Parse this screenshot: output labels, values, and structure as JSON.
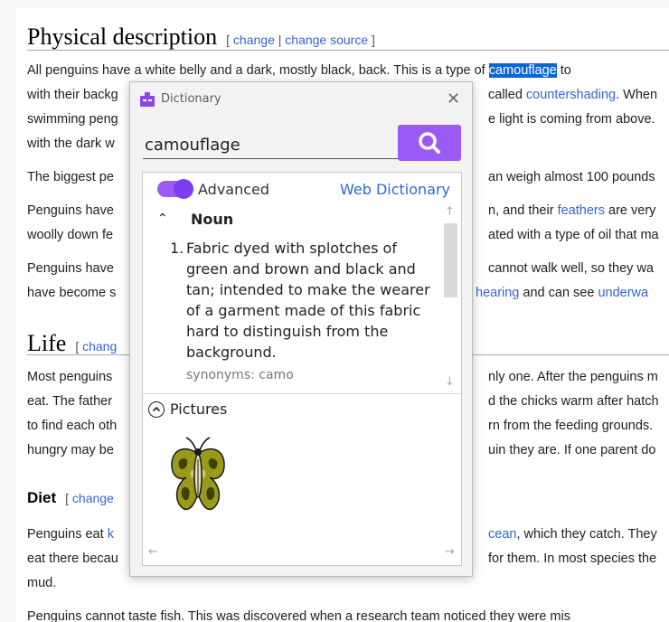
{
  "article": {
    "h_physical": "Physical description",
    "edit_open": "[",
    "edit_sep": "|",
    "edit_close": "]",
    "edit_change": "change",
    "edit_change_source": "change source",
    "p1": {
      "a": "All penguins have a white belly and a dark, mostly black, back. This is a type of ",
      "camouflage": "camouflage",
      "b": " to",
      "l2a": "with their backg",
      "l2b": "called ",
      "countershading": "countershading",
      "l2c": ". When",
      "l3a": "swimming peng",
      "l3b": "e light is coming from above.",
      "l4a": "with the dark w"
    },
    "p2": {
      "a": "The biggest pe",
      "b": "an weigh almost 100 pounds"
    },
    "p3": {
      "l1a": "Penguins have",
      "l1b": "n, and their ",
      "feathers": "feathers",
      "l1c": " are very",
      "l2a": "woolly down fe",
      "l2b": "ated with a type of oil that ma"
    },
    "p4": {
      "l1a": "Penguins have",
      "l1b": "cannot walk well, so they wa",
      "l2a": "have become s",
      "hearing": "hearing",
      "l2b": " and can see ",
      "underwater": "underwa"
    },
    "h_life": "Life",
    "edit_change_trunc": "chang",
    "p5": {
      "l1a": "Most penguins",
      "l1b": "nly one. After the penguins m",
      "l2a": "eat. The father",
      "l2b": "d the chicks warm after hatch",
      "l3a": "to find each oth",
      "l3b": "rn from the feeding grounds.",
      "l4a": "hungry may be",
      "l4b": "uin they are. If one parent do"
    },
    "h_diet": "Diet",
    "edit_change_diet": "change",
    "p6": {
      "l1a": "Penguins eat ",
      "k": "k",
      "ocean": "cean",
      "l1b": ", which they catch. They",
      "l2a": "eat there becau",
      "l2b": "for them. In most species the",
      "l3a": "mud."
    },
    "p7": "Penguins cannot taste fish. This was discovered when a research team noticed they were mis"
  },
  "dictionary": {
    "title": "Dictionary",
    "close": "✕",
    "search_value": "camouflage",
    "search_icon": "search-icon",
    "advanced_label": "Advanced",
    "advanced_on": true,
    "web_dictionary": "Web Dictionary",
    "noun_chevron": "⌃",
    "pos": "Noun",
    "def_number": "1.",
    "definition": "Fabric dyed with splotches of green and brown and black and tan; intended to make the wearer of a garment made of this fabric hard to distinguish from the background.",
    "synonyms": "synonyms: camo",
    "pictures_label": "Pictures",
    "scroll_up": "↑",
    "scroll_down": "↓",
    "scroll_left": "←",
    "scroll_right": "→",
    "accent": "#9b59f5"
  }
}
